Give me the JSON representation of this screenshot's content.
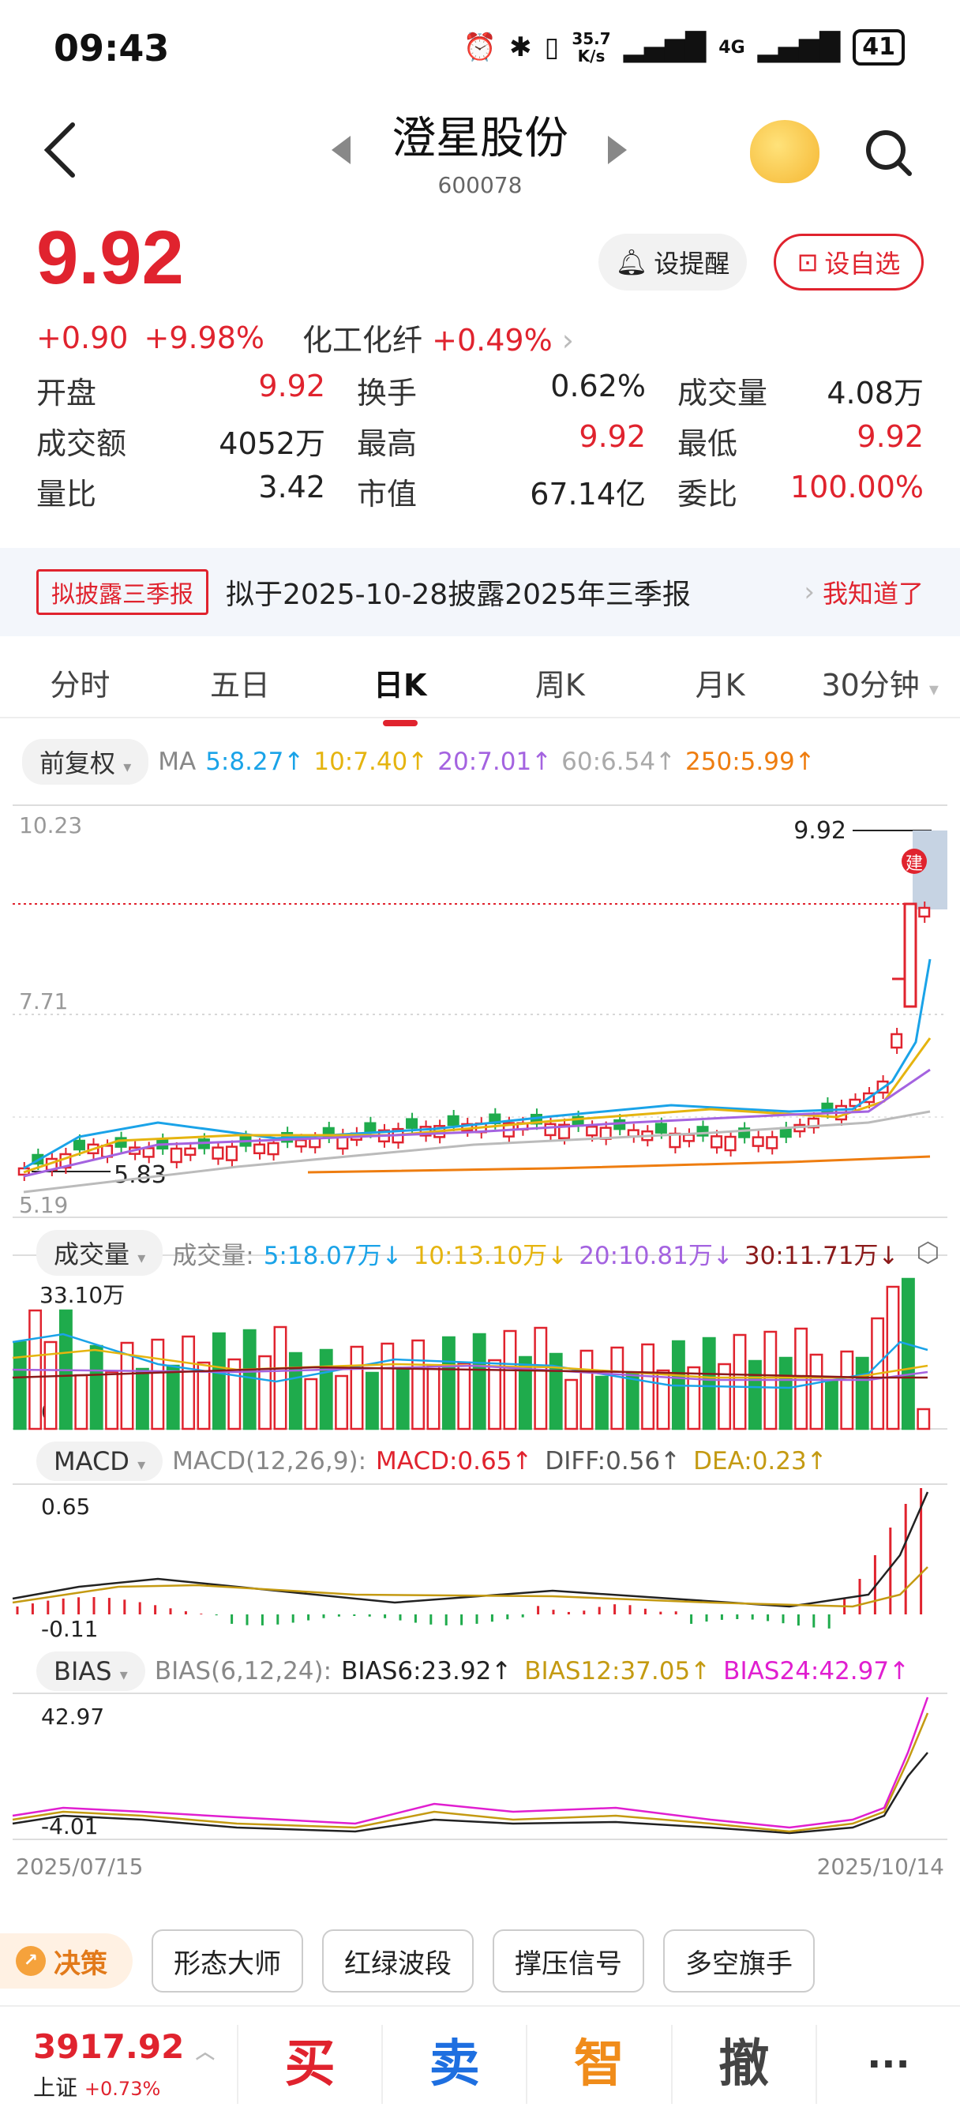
{
  "status": {
    "time": "09:43",
    "net_speed_top": "35.7",
    "net_speed_bottom": "K/s",
    "network": "4G",
    "battery": "41"
  },
  "nav": {
    "title": "澄星股份",
    "code": "600078"
  },
  "quote": {
    "price": "9.92",
    "change": "+0.90",
    "change_pct": "+9.98%",
    "sector": "化工化纤",
    "sector_pct": "+0.49%",
    "alert_label": "设提醒",
    "fav_label": "设自选",
    "stats": [
      [
        {
          "label": "开盘",
          "value": "9.92",
          "color": "red"
        },
        {
          "label": "换手",
          "value": "0.62%",
          "color": "black"
        },
        {
          "label": "成交量",
          "value": "4.08万",
          "color": "black"
        }
      ],
      [
        {
          "label": "成交额",
          "value": "4052万",
          "color": "black"
        },
        {
          "label": "最高",
          "value": "9.92",
          "color": "red"
        },
        {
          "label": "最低",
          "value": "9.92",
          "color": "red"
        }
      ],
      [
        {
          "label": "量比",
          "value": "3.42",
          "color": "black"
        },
        {
          "label": "市值",
          "value": "67.14亿",
          "color": "black"
        },
        {
          "label": "委比",
          "value": "100.00%",
          "color": "red"
        }
      ]
    ]
  },
  "banner": {
    "tag": "拟披露三季报",
    "text": "拟于2025-10-28披露2025年三季报",
    "action": "我知道了"
  },
  "tabs": [
    "分时",
    "五日",
    "日K",
    "周K",
    "月K",
    "30分钟"
  ],
  "kline": {
    "adjust": "前复权",
    "ma_label": "MA",
    "ma": [
      {
        "text": "5:8.27↑",
        "color": "#1aa3e8"
      },
      {
        "text": "10:7.40↑",
        "color": "#e5b40f"
      },
      {
        "text": "20:7.01↑",
        "color": "#a463e0"
      },
      {
        "text": "60:6.54↑",
        "color": "#aaaaaa"
      },
      {
        "text": "250:5.99↑",
        "color": "#ee7d10"
      }
    ],
    "y_max": "10.23",
    "y_mid": "7.71",
    "y_min": "5.19",
    "low_mark": "5.83",
    "last_price": "9.92",
    "jian": "建"
  },
  "volume": {
    "label": "成交量",
    "prefix": "成交量:",
    "ma": [
      {
        "text": "5:18.07万↓",
        "color": "#1aa3e8"
      },
      {
        "text": "10:13.10万↓",
        "color": "#e5b40f"
      },
      {
        "text": "20:10.81万↓",
        "color": "#a463e0"
      },
      {
        "text": "30:11.71万↓",
        "color": "#8b1a1a"
      }
    ],
    "y_max": "33.10万",
    "y_min": "0"
  },
  "macd": {
    "label": "MACD",
    "params": "MACD(12,26,9):",
    "values": [
      {
        "text": "MACD:0.65↑",
        "color": "#e0232e"
      },
      {
        "text": "DIFF:0.56↑",
        "color": "#555555"
      },
      {
        "text": "DEA:0.23↑",
        "color": "#c49a12"
      }
    ],
    "y_max": "0.65",
    "y_min": "-0.11"
  },
  "bias": {
    "label": "BIAS",
    "params": "BIAS(6,12,24):",
    "values": [
      {
        "text": "BIAS6:23.92↑",
        "color": "#222222"
      },
      {
        "text": "BIAS12:37.05↑",
        "color": "#c49a12"
      },
      {
        "text": "BIAS24:42.97↑",
        "color": "#e01fd0"
      }
    ],
    "y_max": "42.97",
    "y_min": "-4.01"
  },
  "dates": {
    "start": "2025/07/15",
    "end": "2025/10/14"
  },
  "toolbar": {
    "decision": "决策",
    "tools": [
      "形态大师",
      "红绿波段",
      "撑压信号",
      "多空旗手"
    ]
  },
  "bottom": {
    "index_value": "3917.92",
    "index_name": "上证",
    "index_pct": "+0.73%",
    "buy": "买",
    "sell": "卖",
    "smart": "智",
    "cancel": "撤",
    "more": "···"
  }
}
